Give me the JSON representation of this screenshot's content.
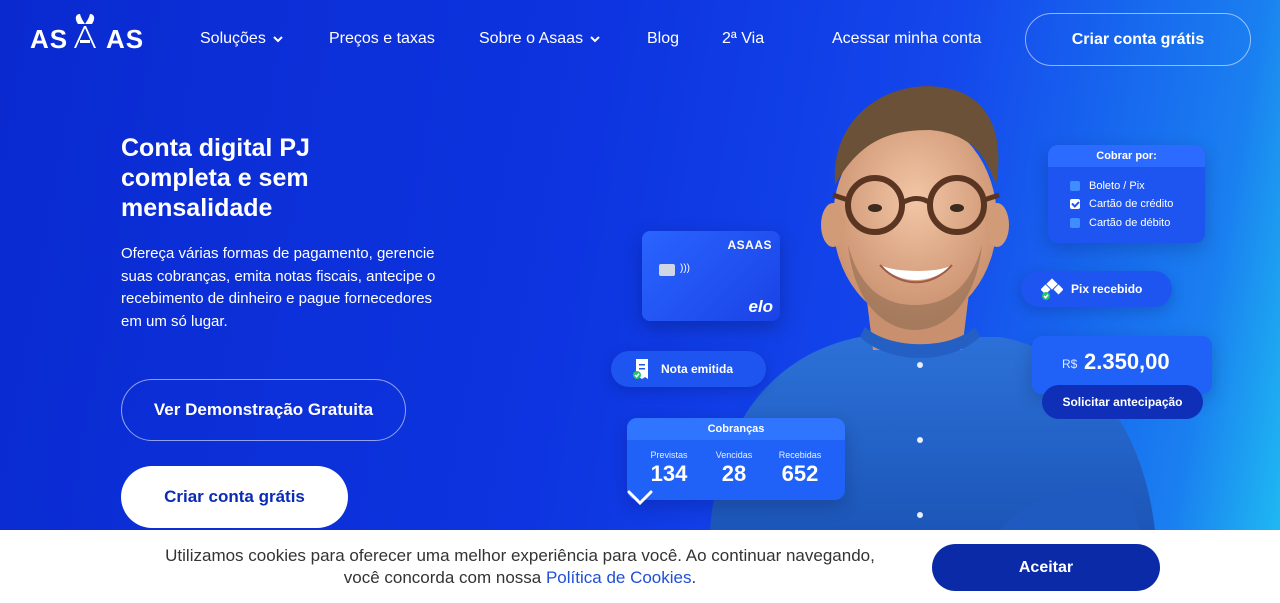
{
  "brand": {
    "name": "ASAAS"
  },
  "nav": {
    "items": [
      {
        "label": "Soluções",
        "dropdown": true
      },
      {
        "label": "Preços e taxas",
        "dropdown": false
      },
      {
        "label": "Sobre o Asaas",
        "dropdown": true
      },
      {
        "label": "Blog",
        "dropdown": false
      },
      {
        "label": "2ª Via",
        "dropdown": false
      }
    ],
    "login_label": "Acessar minha conta",
    "signup_label": "Criar conta grátis"
  },
  "hero": {
    "title": "Conta digital PJ completa e sem mensalidade",
    "description": "Ofereça várias formas de pagamento, gerencie suas cobranças, emita notas fiscais, antecipe o recebimento de dinheiro e pague fornecedores em um só lugar.",
    "demo_button": "Ver Demonstração Gratuita",
    "create_button": "Criar conta grátis"
  },
  "card": {
    "brand": "ASAAS",
    "network": "elo"
  },
  "nota_pill": "Nota emitida",
  "pix_pill": "Pix recebido",
  "cobrar_por": {
    "title": "Cobrar por:",
    "options": [
      {
        "label": "Boleto / Pix",
        "checked": false
      },
      {
        "label": "Cartão de crédito",
        "checked": true
      },
      {
        "label": "Cartão de débito",
        "checked": false
      }
    ]
  },
  "balance": {
    "currency": "R$",
    "value": "2.350,00",
    "button": "Solicitar antecipação"
  },
  "cobrancas": {
    "title": "Cobranças",
    "cols": [
      {
        "label": "Previstas",
        "value": "134"
      },
      {
        "label": "Vencidas",
        "value": "28"
      },
      {
        "label": "Recebidas",
        "value": "652"
      }
    ]
  },
  "cookie": {
    "text": "Utilizamos cookies para oferecer uma melhor experiência para você. Ao continuar navegando, você concorda com nossa ",
    "link": "Política de Cookies",
    "suffix": ".",
    "accept": "Aceitar"
  },
  "colors": {
    "primary": "#0b2fd6",
    "accent_light": "#1fb8f2",
    "button_dark": "#0b2aa8"
  },
  "icons": [
    "chevron-down-icon",
    "receipt-icon",
    "pix-icon",
    "check-icon",
    "scroll-down-icon"
  ]
}
